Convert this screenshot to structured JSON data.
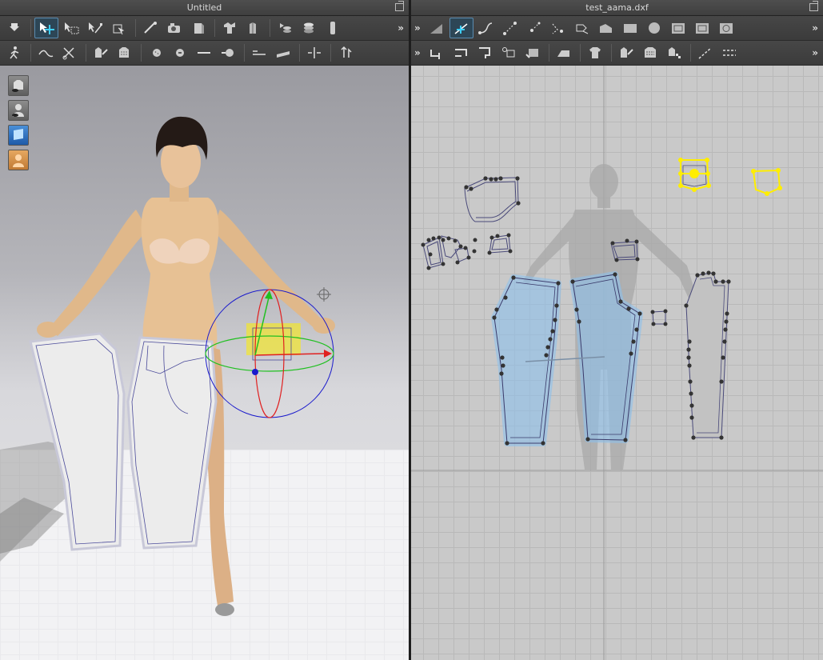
{
  "left_window": {
    "title": "Untitled"
  },
  "right_window": {
    "title": "test_aama.dxf"
  },
  "toolbar_overflow": "»",
  "left_toolbar_row1": [
    "select-arrow-icon",
    "transform-pattern-icon",
    "select-mesh-icon",
    "edit-points-icon",
    "move-icon",
    "draw-line-icon",
    "camera-icon",
    "fold-icon",
    "tack-icon",
    "avatar-fit-icon",
    "layer-icon",
    "stack-icon",
    "pin-icon"
  ],
  "left_toolbar_row2": [
    "walk-icon",
    "seam-line-icon",
    "scissors-icon",
    "garment-property-icon",
    "texture-icon",
    "button-icon",
    "button-hole-icon",
    "zipper-icon",
    "snap-icon",
    "tape-icon",
    "ruler-icon",
    "arrange-icon",
    "upload-icon"
  ],
  "right_toolbar_row1": [
    "edit-pattern-icon",
    "edit-curve-icon",
    "curve-point-icon",
    "add-point-icon",
    "offset-icon",
    "trace-icon",
    "polygon-icon",
    "rectangle-icon",
    "circle-icon",
    "internal-rect-icon",
    "internal-square-icon",
    "internal-circle-icon"
  ],
  "right_toolbar_row2": [
    "segment-sew-icon",
    "free-sew-icon",
    "fold-sew-icon",
    "edit-sew-icon",
    "check-sew-icon",
    "iron-icon",
    "shirt-property-icon",
    "texture-edit-icon",
    "pattern-fill-icon",
    "checker-icon",
    "measure-icon",
    "dashed-line-icon"
  ],
  "avatar_side_tools": [
    "garment-visibility-icon",
    "avatar-visibility-icon",
    "view-mode-icon",
    "avatar-skin-icon"
  ],
  "colors": {
    "selection": "#ffee00",
    "piece_outline": "#4a4a7a",
    "selected_piece": "#8ec1ec",
    "gizmo_x": "#e02020",
    "gizmo_y": "#20c020",
    "gizmo_z": "#1a1acc"
  }
}
